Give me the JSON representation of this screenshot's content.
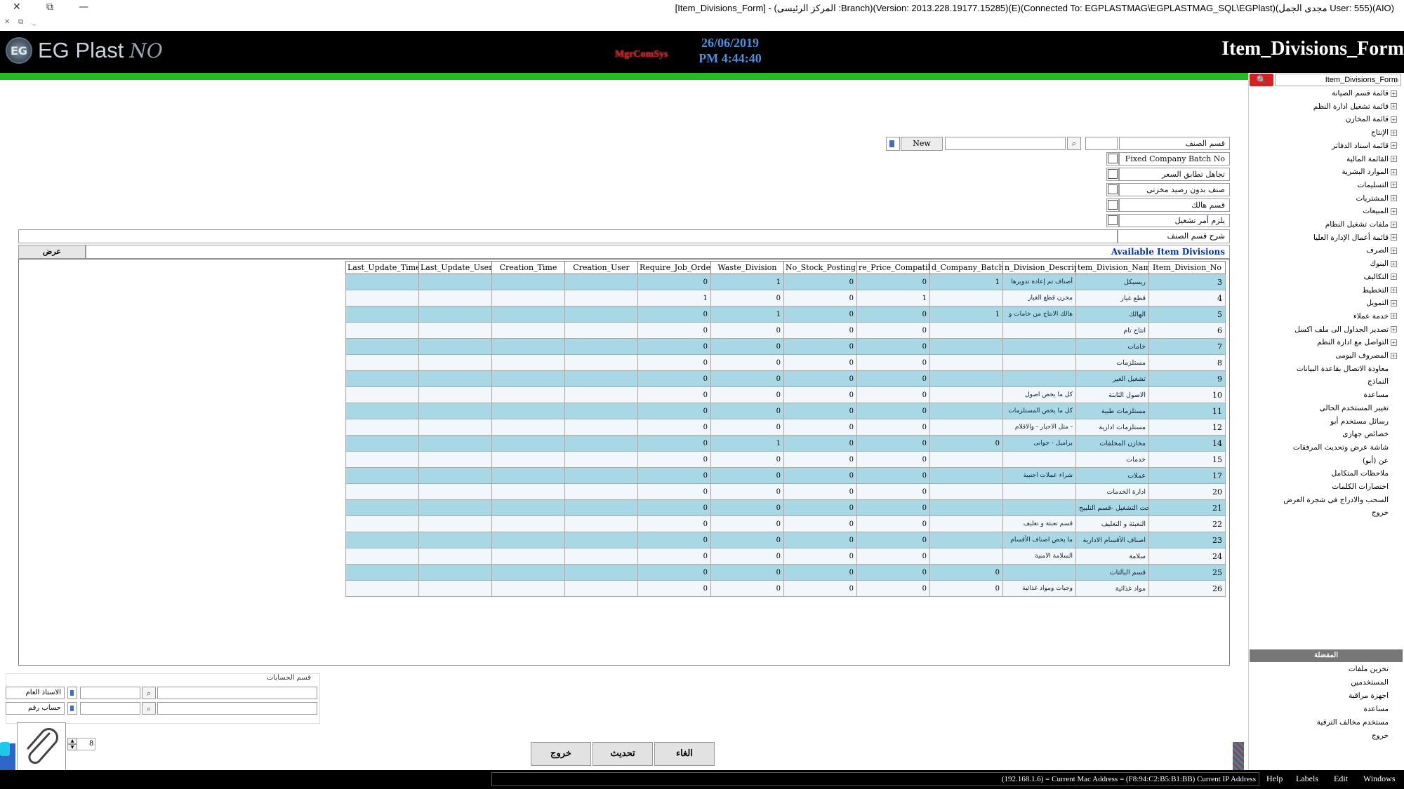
{
  "window": {
    "title": "[Item_Divisions_Form] - (المركز الرئيسى :Branch)(Version: 2013.228.19177.15285)(E)(Connected To: EGPLASTMAG\\EGPLASTMAG_SQL\\EGPlast)(مجدى الجمل User: 555)(AIO)",
    "close_glyph": "✕",
    "restore_glyph": "⧉",
    "min_glyph": "—"
  },
  "mini_controls": {
    "close": "✕",
    "restore": "⧉",
    "min": "_"
  },
  "header": {
    "logo_text": "EG Plast",
    "logo_signature": "NO",
    "logo_badge": "EG",
    "mgmt_logo": "MgrComSys",
    "date": "26/06/2019",
    "time": "PM 4:44:40",
    "form_title": "Item_Divisions_Form"
  },
  "search": {
    "value": "Item_Divisions_Form",
    "button_glyph": "🔍"
  },
  "tree": [
    "قائمة قسم الصيانة",
    "قائمة تشغيل ادارة النظم",
    "قائمة المخازن",
    "الإنتاج",
    "قائمة اسناد الدفاتر",
    "القائمة المالية",
    "الموارد البشرية",
    "التسليمات",
    "المشتريات",
    "المبيعات",
    "ملفات تشغيل النظام",
    "قائمة أعمال الإدارة العليا",
    "الصرف",
    "البنوك",
    "التكاليف",
    "التخطيط",
    "التمويل",
    "خدمة عملاء",
    "تصدير الجداول الى ملف اكسل",
    "التواصل مع ادارة النظم",
    "المصروف اليومى"
  ],
  "tree_leaves": [
    "معاودة الاتصال بقاعدة البيانات",
    "النماذج",
    "مساعدة",
    "تغيير المستخدم الحالى",
    "رسائل مستخدم أبو",
    "خصائص جهازى",
    "شاشة عرض وتحديث المرفقات",
    "عن (أبو)",
    "ملاحظات المتكامل",
    "اختصارات الكلمات",
    "السحب والادراج فى شجرة العرض",
    "خروج"
  ],
  "favorites": {
    "header": "المفضلة",
    "items": [
      "تخزين ملفات",
      "المستخدمين",
      "اجهزة مراقبة",
      "مساعدة",
      "مستخدم مخالف الترقية",
      "خروج"
    ]
  },
  "form": {
    "division_label": "قسم الصنف",
    "division_value": "",
    "new_label": "New",
    "search_value": "",
    "checkboxes": [
      {
        "label": "Fixed Company Batch No",
        "checked": false
      },
      {
        "label": "تجاهل تطابق السعر",
        "checked": false
      },
      {
        "label": "صنف بدون رصيد مخزنى",
        "checked": false
      },
      {
        "label": "قسم هالك",
        "checked": false
      },
      {
        "label": "يلزم أمر تشغيل",
        "checked": false
      }
    ],
    "description_label": "شرح قسم الصنف",
    "display_button": "عرض",
    "available_title": "Available Item Divisions"
  },
  "grid": {
    "columns": [
      "Last_Update_Time",
      "Last_Update_User",
      "Creation_Time",
      "Creation_User",
      "Require_Job_Order",
      "Waste_Division",
      "No_Stock_Posting",
      "re_Price_Compatibi",
      "d_Company_Batch_",
      "n_Division_Descript",
      "tem_Division_Name",
      "Item_Division_No"
    ],
    "rows": [
      [
        "",
        "",
        "",
        "",
        "0",
        "1",
        "0",
        "0",
        "1",
        "أصناف تم إعادة تدويرها",
        "ريسيكل",
        "3"
      ],
      [
        "",
        "",
        "",
        "",
        "1",
        "0",
        "0",
        "1",
        "",
        "مخزن قطع الغيار",
        "قطع غيار",
        "4"
      ],
      [
        "",
        "",
        "",
        "",
        "0",
        "1",
        "0",
        "0",
        "1",
        "هالك الانتاج من خامات و",
        "الهالك",
        "5"
      ],
      [
        "",
        "",
        "",
        "",
        "0",
        "0",
        "0",
        "0",
        "",
        "",
        "انتاج تام",
        "6"
      ],
      [
        "",
        "",
        "",
        "",
        "0",
        "0",
        "0",
        "0",
        "",
        "",
        "خامات",
        "7"
      ],
      [
        "",
        "",
        "",
        "",
        "0",
        "0",
        "0",
        "0",
        "",
        "",
        "مستلزمات",
        "8"
      ],
      [
        "",
        "",
        "",
        "",
        "0",
        "0",
        "0",
        "0",
        "",
        "",
        "تشغيل الغير",
        "9"
      ],
      [
        "",
        "",
        "",
        "",
        "0",
        "0",
        "0",
        "0",
        "",
        "كل ما يخص اصول",
        "الاصول الثابتة",
        "10"
      ],
      [
        "",
        "",
        "",
        "",
        "0",
        "0",
        "0",
        "0",
        "",
        "كل ما يخص المستلزمات",
        "مستلزمات طبية",
        "11"
      ],
      [
        "",
        "",
        "",
        "",
        "0",
        "0",
        "0",
        "0",
        "",
        "مثل الاحبار - والاقلام -",
        "مستلزمات ادارية",
        "12"
      ],
      [
        "",
        "",
        "",
        "",
        "0",
        "1",
        "0",
        "0",
        "0",
        "براميل - جوانى",
        "مخازن المخلفات",
        "14"
      ],
      [
        "",
        "",
        "",
        "",
        "0",
        "0",
        "0",
        "0",
        "",
        "",
        "خدمات",
        "15"
      ],
      [
        "",
        "",
        "",
        "",
        "0",
        "0",
        "0",
        "0",
        "",
        "شراء عملات اجنبية",
        "عملات",
        "17"
      ],
      [
        "",
        "",
        "",
        "",
        "0",
        "0",
        "0",
        "0",
        "",
        "",
        "ادارة الخدمات",
        "20"
      ],
      [
        "",
        "",
        "",
        "",
        "0",
        "0",
        "0",
        "0",
        "",
        "",
        "تحت التشغيل -قسم التلبيح",
        "21"
      ],
      [
        "",
        "",
        "",
        "",
        "0",
        "0",
        "0",
        "0",
        "",
        "قسم تعبئة و تغليف",
        "التعبئة و التغليف",
        "22"
      ],
      [
        "",
        "",
        "",
        "",
        "0",
        "0",
        "0",
        "0",
        "",
        "ما يخص اصناف الأقسام",
        "اصناف الأقسام الادارية",
        "23"
      ],
      [
        "",
        "",
        "",
        "",
        "0",
        "0",
        "0",
        "0",
        "",
        "السلامة الامنية",
        "سلامة",
        "24"
      ],
      [
        "",
        "",
        "",
        "",
        "0",
        "0",
        "0",
        "0",
        "0",
        "",
        "قسم البالتات",
        "25"
      ],
      [
        "",
        "",
        "",
        "",
        "0",
        "0",
        "0",
        "0",
        "0",
        "وجبات ومواد غذائية",
        "مواد غذائية",
        "26"
      ]
    ]
  },
  "accounts": {
    "title": "قسم الحسابات",
    "general_ledger_label": "الاستاذ العام",
    "account_no_label": "حساب رقم"
  },
  "pager": {
    "value": "8"
  },
  "buttons": {
    "exit": "خروج",
    "update": "تحديث",
    "cancel": "الغاء"
  },
  "status": {
    "ip_text": "(192.168.1.6) = Current Mac Address = (F8:94:C2:B5:B1:BB) Current IP Address",
    "menu": [
      "Help",
      "Labels",
      "Edit",
      "Windows"
    ]
  },
  "colors": {
    "header_bg": "#000000",
    "green_bar": "#1fbf1f",
    "row_alt": "#a8d8e6",
    "search_red": "#d92020",
    "date_blue": "#4a8fe0"
  }
}
